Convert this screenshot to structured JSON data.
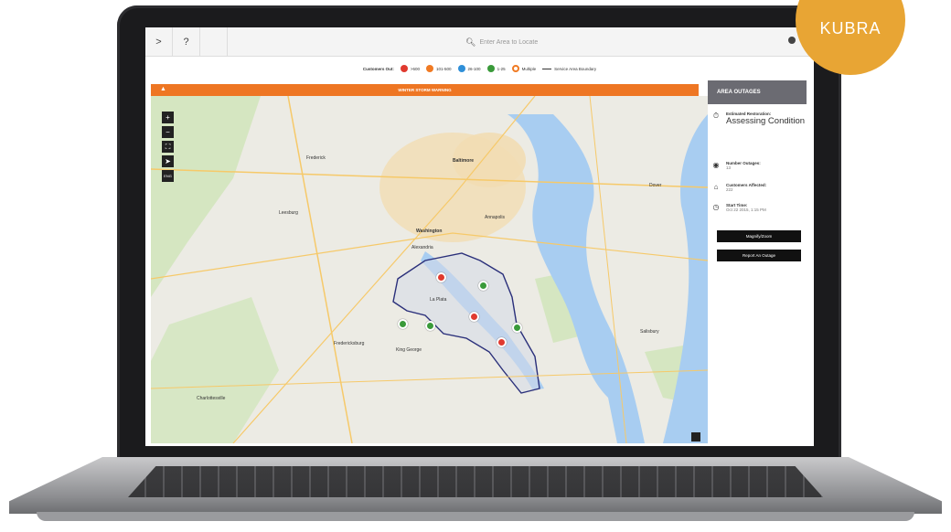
{
  "brand": {
    "badge": "KUBRA",
    "badge_color": "#e8a534"
  },
  "topbar": {
    "menu_icon": "chevron-right-icon",
    "menu_label": ">",
    "help_label": "?",
    "search_placeholder": "Enter Area to Locate",
    "search_icon": "search-icon",
    "locate_icon": "locate-icon"
  },
  "legend": {
    "title": "Customers Out:",
    "items": [
      {
        "label": ">500",
        "color": "#e03a2f"
      },
      {
        "label": "101-500",
        "color": "#f07a23"
      },
      {
        "label": "26-100",
        "color": "#2f8fd8"
      },
      {
        "label": "1-25",
        "color": "#3a9a3a"
      },
      {
        "label": "Multiple",
        "color": "#f07a23"
      }
    ],
    "boundary_label": "Service Area Boundary"
  },
  "warning": {
    "text": "WINTER STORM WARNING",
    "color": "#ee7623"
  },
  "map": {
    "controls": {
      "zoom_in": "+",
      "zoom_out": "−",
      "fullscreen": "⛶",
      "locate": "➤",
      "language": "ENG"
    },
    "labels": {
      "baltimore": "Baltimore",
      "washington": "Washington",
      "alexandria": "Alexandria",
      "annapolis": "Annapolis",
      "dover": "Dover",
      "charlottesville": "Charlottesville",
      "fredericksburg": "Fredericksburg",
      "la_plata": "La Plata",
      "king_george": "King George",
      "salisbury": "Salisbury",
      "frederick": "Frederick",
      "leesburg": "Leesburg"
    }
  },
  "panel": {
    "header": "AREA OUTAGES",
    "restoration_label": "Estimated Restoration:",
    "restoration_value": "Assessing Condition",
    "outages_label": "Number Outages:",
    "outages_value": "13",
    "affected_label": "Customers Affected:",
    "affected_value": "222",
    "start_label": "Start Time:",
    "start_value": "Oct 22 2015, 1:15 PM",
    "magnify_button": "Magnify/Zoom",
    "report_button": "Report An Outage"
  }
}
